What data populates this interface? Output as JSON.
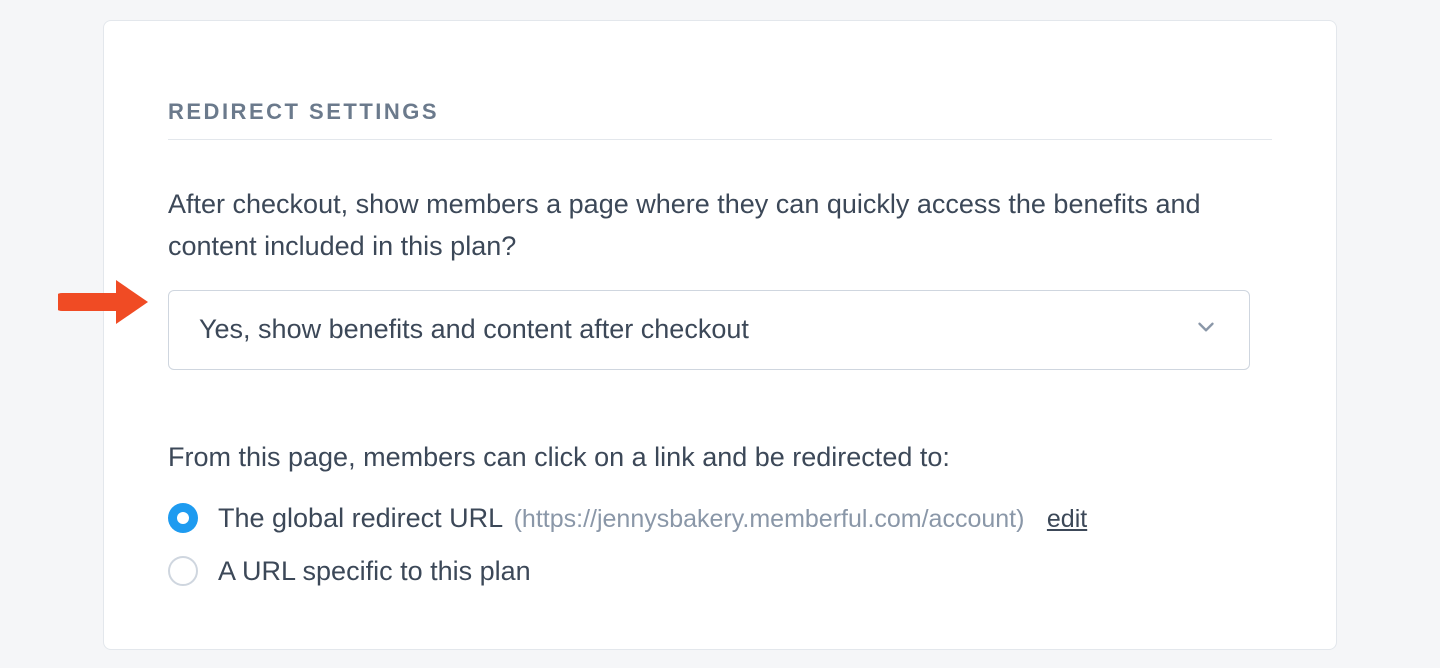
{
  "section_title": "REDIRECT SETTINGS",
  "description": "After checkout, show members a page where they can quickly access the benefits and content included in this plan?",
  "select": {
    "value": "Yes, show benefits and content after checkout"
  },
  "sub_description": "From this page, members can click on a link and be redirected to:",
  "radios": {
    "global": {
      "label": "The global redirect URL",
      "url_display": "(https://jennysbakery.memberful.com/account)",
      "edit": "edit",
      "selected": true
    },
    "specific": {
      "label": "A URL specific to this plan",
      "selected": false
    }
  }
}
